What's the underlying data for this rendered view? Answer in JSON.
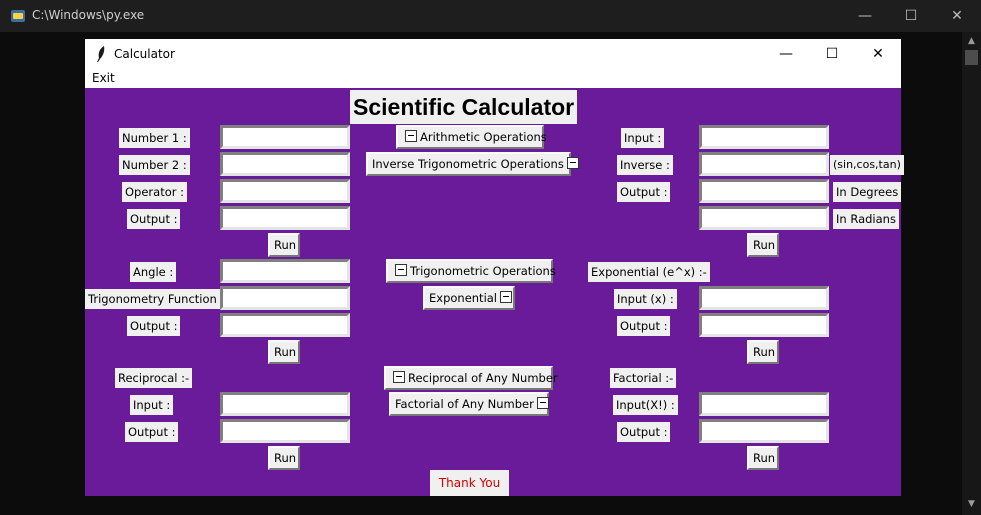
{
  "console": {
    "title": "C:\\Windows\\py.exe",
    "minimize": "—",
    "maximize": "☐",
    "close": "✕",
    "scroll_up": "▲",
    "scroll_down": "▼"
  },
  "window": {
    "title": "Calculator",
    "minimize": "—",
    "maximize": "☐",
    "close": "✕",
    "menu": {
      "exit": "Exit"
    }
  },
  "heading": "Scientific Calculator",
  "arithmetic": {
    "number1_label": "Number 1 :",
    "number2_label": "Number 2 :",
    "operator_label": "Operator :",
    "output_label": "Output :",
    "number1": "",
    "number2": "",
    "operator": "",
    "output": "",
    "run": "Run"
  },
  "inverse_trig": {
    "input_label": "Input :",
    "inverse_label": "Inverse :",
    "output_label": "Output :",
    "hint": "(sin,cos,tan)",
    "degrees_label": "In Degrees",
    "radians_label": "In Radians",
    "input": "",
    "inverse": "",
    "output_degrees": "",
    "output_radians": "",
    "run": "Run"
  },
  "trigonometry": {
    "angle_label": "Angle :",
    "function_label": "Trigonometry Function :",
    "output_label": "Output :",
    "angle": "",
    "function": "",
    "output": "",
    "run": "Run"
  },
  "exponential": {
    "title_label": "Exponential (e^x) :-",
    "input_label": "Input (x) :",
    "output_label": "Output :",
    "input": "",
    "output": "",
    "run": "Run"
  },
  "reciprocal": {
    "title_label": "Reciprocal :-",
    "input_label": "Input :",
    "output_label": "Output :",
    "input": "",
    "output": "",
    "run": "Run"
  },
  "factorial": {
    "title_label": "Factorial :-",
    "input_label": "Input(X!) :",
    "output_label": "Output :",
    "input": "",
    "output": "",
    "run": "Run"
  },
  "toggles": {
    "arithmetic": "Arithmetic Operations",
    "inverse_trig": "Inverse Trigonometric Operations",
    "trigonometric": "Trigonometric Operations",
    "exponential": "Exponential",
    "reciprocal": "Reciprocal of Any Number",
    "factorial": "Factorial of Any Number"
  },
  "footer": {
    "thank_you": "Thank You"
  },
  "colors": {
    "canvas": "#6a1b9a",
    "thank_you_text": "#d00000"
  }
}
